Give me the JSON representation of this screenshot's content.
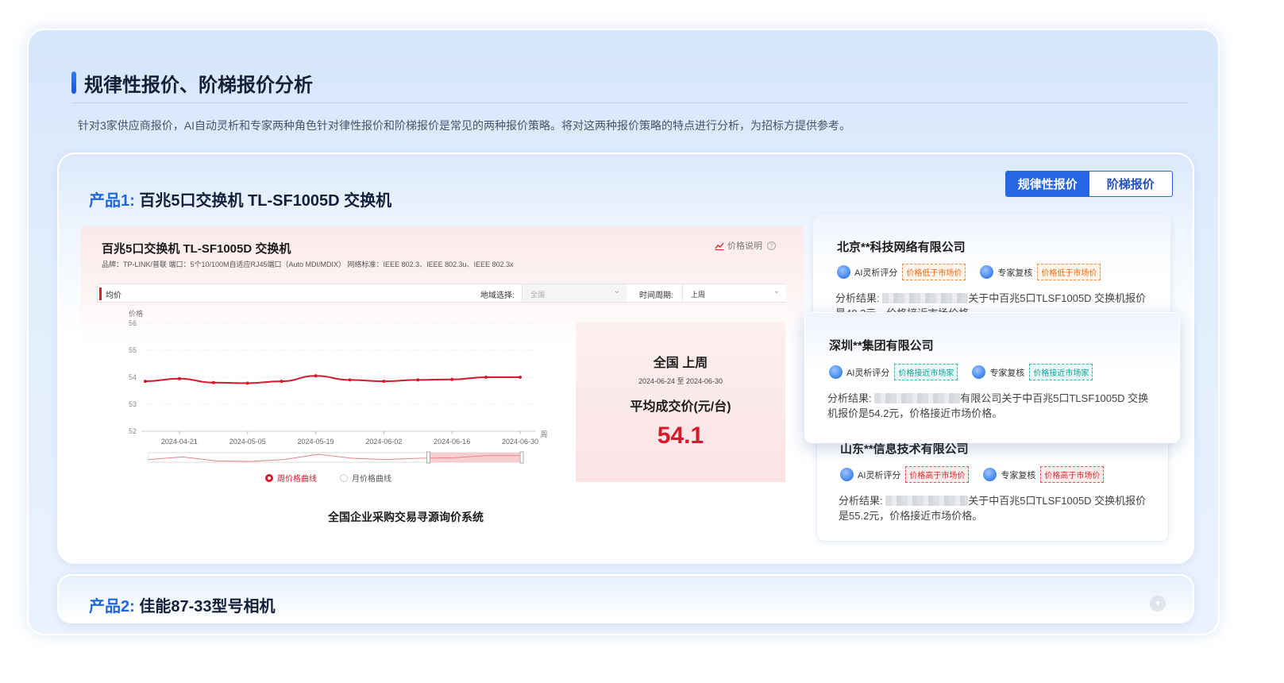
{
  "section": {
    "title": "规律性报价、阶梯报价分析",
    "description": "针对3家供应商报价，AI自动灵析和专家两种角色针对律性报价和阶梯报价是常见的两种报价策略。将对这两种报价策略的特点进行分析，为招标方提供参考。"
  },
  "product1": {
    "label": "产品1:",
    "name": "百兆5口交换机 TL-SF1005D 交换机",
    "tabs": [
      "规律性报价",
      "阶梯报价"
    ],
    "active_tab": "规律性报价"
  },
  "panel": {
    "title": "百兆5口交换机 TL-SF1005D 交换机",
    "specs": "品牌：TP-LINK/普联    端口：5个10/100M自适应RJ45端口（Auto MDI/MDIX）    网络标准：IEEE 802.3、IEEE 802.3u、IEEE 802.3x",
    "help": "价格说明",
    "metric_label": "均价",
    "region_label": "地域选择:",
    "region_value": "全国",
    "period_label": "时间周期:",
    "period_value": "上周",
    "summary": {
      "scope": "全国 上周",
      "range": "2024-06-24 至 2024-06-30",
      "metric": "平均成交价(元/台)",
      "value": "54.1"
    },
    "legend": [
      "周价格曲线",
      "月价格曲线"
    ],
    "caption": "全国企业采购交易寻源询价系统"
  },
  "chart_data": {
    "type": "line",
    "ylabel": "价格",
    "xlabel": "周",
    "ylim": [
      52,
      56
    ],
    "yticks": [
      52,
      53,
      54,
      55,
      56
    ],
    "x_tick_labels": [
      "2024-04-21",
      "2024-05-05",
      "2024-05-19",
      "2024-06-02",
      "2024-06-16",
      "2024-06-30"
    ],
    "x": [
      "2024-04-14",
      "2024-04-21",
      "2024-04-28",
      "2024-05-05",
      "2024-05-12",
      "2024-05-19",
      "2024-05-26",
      "2024-06-02",
      "2024-06-09",
      "2024-06-16",
      "2024-06-23",
      "2024-06-30"
    ],
    "series": [
      {
        "name": "周价格曲线",
        "values": [
          53.85,
          53.95,
          53.8,
          53.78,
          53.85,
          54.05,
          53.9,
          53.85,
          53.9,
          53.92,
          54.0,
          54.0
        ]
      }
    ],
    "grid": true,
    "colors": {
      "line": "#d6192b"
    }
  },
  "vendors": [
    {
      "name": "北京**科技网络有限公司",
      "ai_label": "AI灵析评分",
      "ai_tag": "价格低于市场价",
      "expert_label": "专家复核",
      "expert_tag": "价格低于市场价",
      "analysis_label": "分析结果:",
      "analysis_text": "关于中百兆5口TLSF1005D 交换机报价是48.2元，价格接近市场价格。"
    },
    {
      "name": "深圳**集团有限公司",
      "ai_label": "AI灵析评分",
      "ai_tag": "价格接近市场家",
      "expert_label": "专家复核",
      "expert_tag": "价格接近市场家",
      "analysis_label": "分析结果:",
      "analysis_text": "有限公司关于中百兆5口TLSF1005D 交换机报价是54.2元，价格接近市场价格。"
    },
    {
      "name": "山东**信息技术有限公司",
      "ai_label": "AI灵析评分",
      "ai_tag": "价格高于市场价",
      "expert_label": "专家复核",
      "expert_tag": "价格高于市场价",
      "analysis_label": "分析结果:",
      "analysis_text": "关于中百兆5口TLSF1005D 交换机报价是55.2元，价格接近市场价格。"
    }
  ],
  "product2": {
    "label": "产品2:",
    "name": "佳能87-33型号相机"
  },
  "colors": {
    "accent": "#2667e6",
    "price_red": "#d6192b",
    "tag_low": "#f06a12",
    "tag_near": "#11a39c",
    "tag_high": "#e0272f"
  },
  "icons": [
    "chart-icon",
    "help-icon",
    "ai-avatar-icon",
    "expert-avatar-icon",
    "chevron-down-icon",
    "expand-icon"
  ]
}
